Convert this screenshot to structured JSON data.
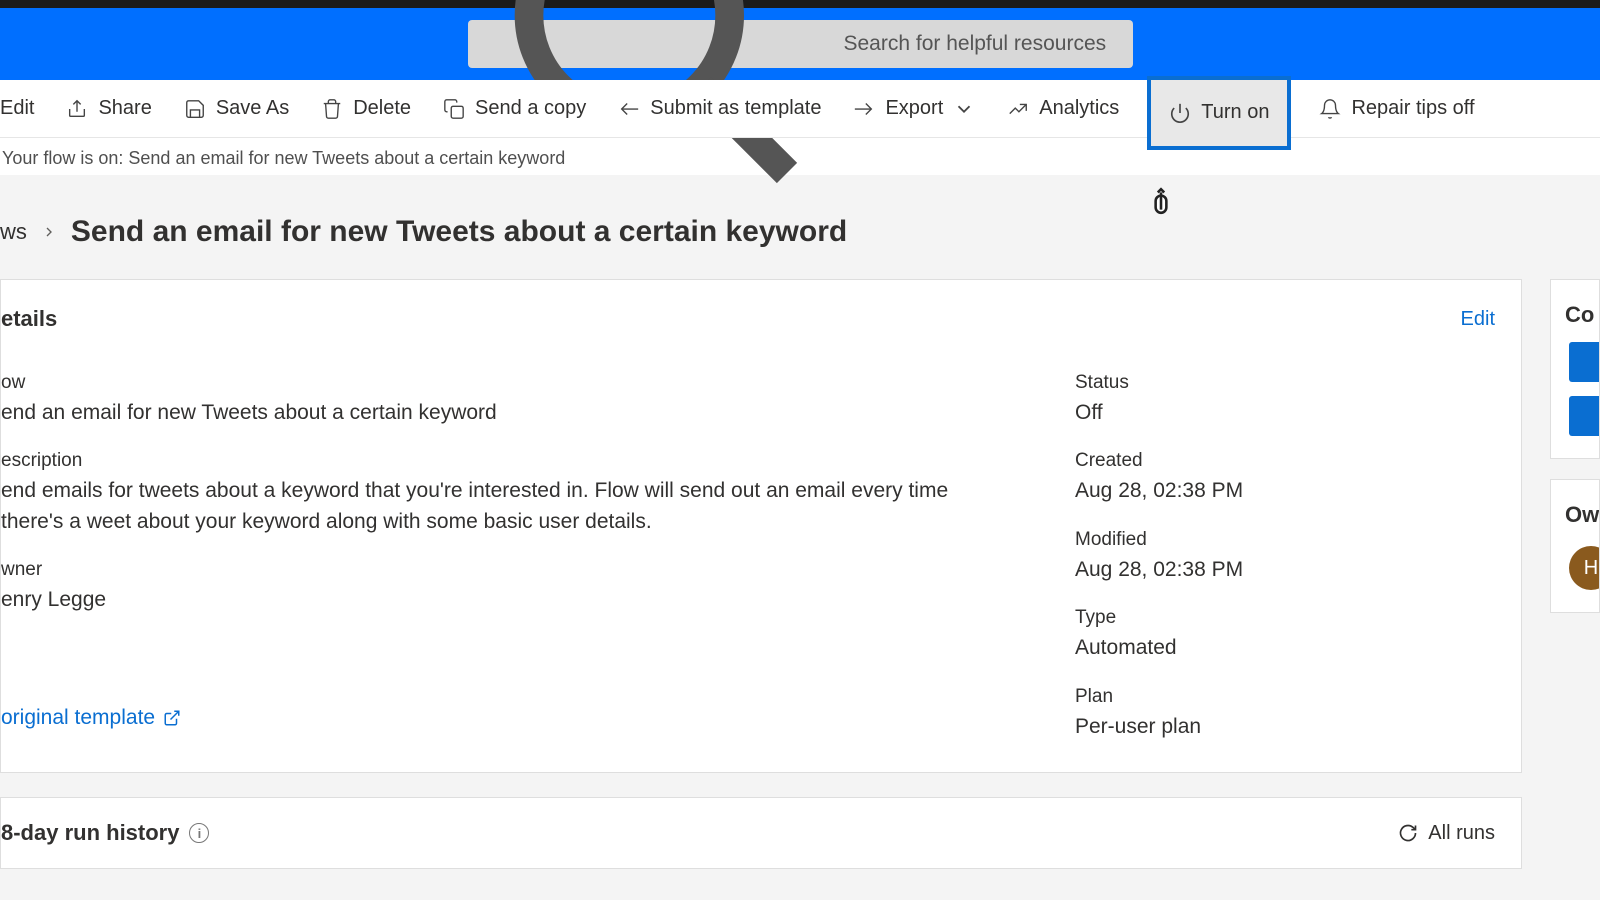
{
  "search": {
    "placeholder": "Search for helpful resources"
  },
  "toolbar": {
    "edit": "Edit",
    "share": "Share",
    "save_as": "Save As",
    "delete": "Delete",
    "send_copy": "Send a copy",
    "submit_template": "Submit as template",
    "export": "Export",
    "analytics": "Analytics",
    "turn_on": "Turn on",
    "repair_tips": "Repair tips off"
  },
  "status_line": "Your flow is on: Send an email for new Tweets about a certain keyword",
  "breadcrumb": {
    "prev": "ws",
    "title": "Send an email for new Tweets about a certain keyword"
  },
  "details": {
    "heading": "etails",
    "edit": "Edit",
    "flow_label": "ow",
    "flow_value": "end an email for new Tweets about a certain keyword",
    "desc_label": "escription",
    "desc_value": "end emails for tweets about a keyword that you're interested in. Flow will send out an email every time there's a weet about your keyword along with some basic user details.",
    "owner_label": "wner",
    "owner_value": "enry Legge",
    "status_label": "Status",
    "status_value": "Off",
    "created_label": "Created",
    "created_value": "Aug 28, 02:38 PM",
    "modified_label": "Modified",
    "modified_value": "Aug 28, 02:38 PM",
    "type_label": "Type",
    "type_value": "Automated",
    "plan_label": "Plan",
    "plan_value": "Per-user plan",
    "template_link": "original template"
  },
  "side": {
    "co": "Co",
    "ow": "Ow",
    "avatar": "H"
  },
  "history": {
    "title": "8-day run history",
    "allruns": "All runs"
  }
}
